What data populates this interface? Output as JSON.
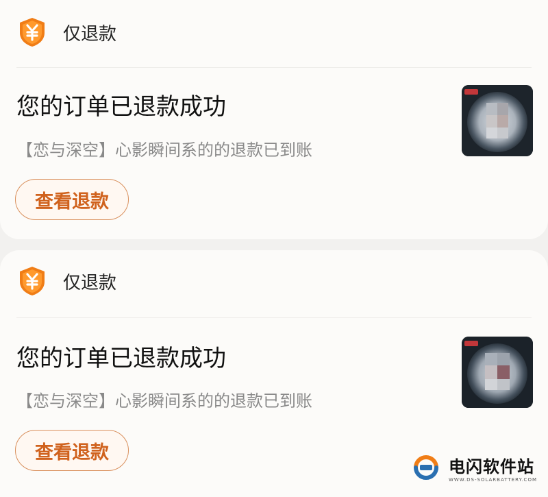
{
  "refunds": [
    {
      "type_label": "仅退款",
      "title": "您的订单已退款成功",
      "detail": "【恋与深空】心影瞬间系的的退款已到账",
      "button_label": "查看退款"
    },
    {
      "type_label": "仅退款",
      "title": "您的订单已退款成功",
      "detail": "【恋与深空】心影瞬间系的的退款已到账",
      "button_label": "查看退款"
    }
  ],
  "watermark": {
    "name": "电闪软件站",
    "url": "WWW.DS-SOLARBATTERY.COM"
  },
  "colors": {
    "accent": "#d0621d",
    "icon_orange": "#f07d16"
  },
  "icons": {
    "refund": "yen-shield-icon"
  }
}
